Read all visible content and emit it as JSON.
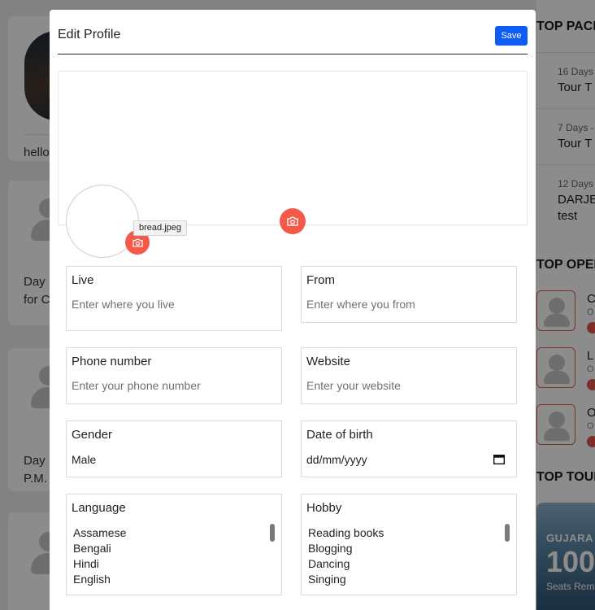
{
  "modal": {
    "title": "Edit Profile",
    "save_label": "Save",
    "file_tooltip": "bread.jpeg"
  },
  "fields": {
    "live": {
      "label": "Live",
      "placeholder": "Enter where you live"
    },
    "from": {
      "label": "From",
      "placeholder": "Enter where you from"
    },
    "phone": {
      "label": "Phone number",
      "placeholder": "Enter your phone number"
    },
    "website": {
      "label": "Website",
      "placeholder": "Enter your website"
    },
    "gender": {
      "label": "Gender",
      "value": "Male"
    },
    "dob": {
      "label": "Date of birth",
      "value": "dd/mm/yyyy"
    },
    "language": {
      "label": "Language",
      "options": [
        "Assamese",
        "Bengali",
        "Hindi",
        "English"
      ]
    },
    "hobby": {
      "label": "Hobby",
      "options": [
        "Reading books",
        "Blogging",
        "Dancing",
        "Singing"
      ]
    }
  },
  "background": {
    "left_texts": [
      "hello",
      "Day",
      "for C",
      "Day",
      "P.M."
    ],
    "sections": [
      "TOP PACK",
      "TOP OPER",
      "TOP TOUR"
    ],
    "packages": [
      {
        "meta": "16 Days",
        "title": "Tour T"
      },
      {
        "meta": "7 Days -",
        "title": "Tour T"
      },
      {
        "meta": "12 Days",
        "title": "DARJE",
        "subtitle": "test"
      }
    ],
    "operators": [
      {
        "letter": "C",
        "sub": "O"
      },
      {
        "letter": "L",
        "sub": "O"
      },
      {
        "letter": "O",
        "sub": "O"
      }
    ],
    "tour_card": {
      "city": "GUJARA",
      "big": "100",
      "seats": "Seats Rem"
    }
  },
  "colors": {
    "primary": "#0d5df5",
    "camera": "#f35a4a",
    "accent_red": "#e0574a"
  }
}
